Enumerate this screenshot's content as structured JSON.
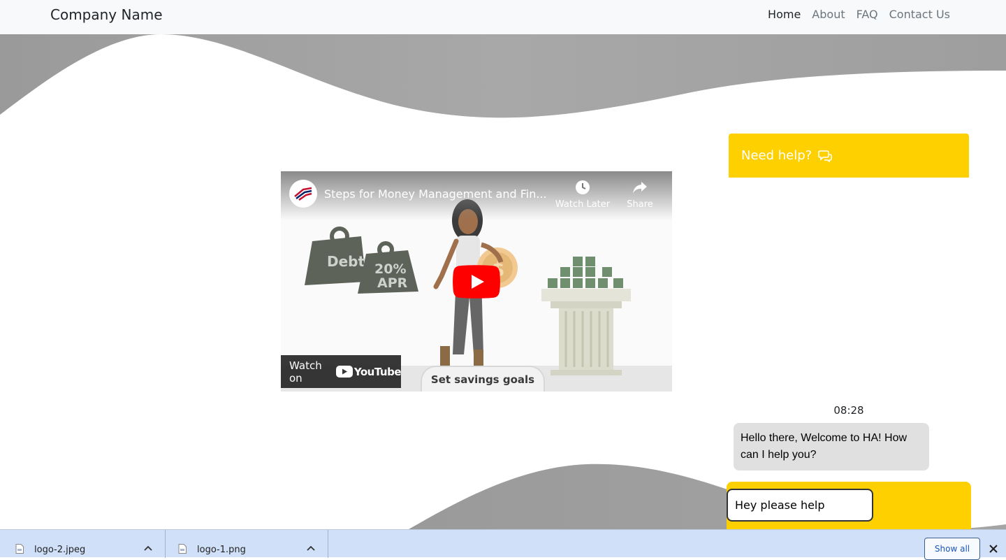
{
  "navbar": {
    "brand": "Company Name",
    "links": [
      {
        "label": "Home",
        "active": true
      },
      {
        "label": "About",
        "active": false
      },
      {
        "label": "FAQ",
        "active": false
      },
      {
        "label": "Contact Us",
        "active": false
      }
    ]
  },
  "video": {
    "title": "Steps for Money Management and Fin...",
    "watch_later": "Watch Later",
    "share": "Share",
    "watch_on": "Watch on",
    "youtube_word": "YouTube",
    "weight_1": "Debt",
    "weight_2_top": "20%",
    "weight_2_bottom": "APR",
    "caption": "Set savings goals"
  },
  "chat": {
    "header_title": "Need help?",
    "header_icon": "chat-bubbles-icon",
    "timestamp": "08:28",
    "bot_message": "Hello there, Welcome to HA! How can I help you?",
    "input_value": "Hey please help",
    "accent": "#ffd000"
  },
  "downloads": {
    "items": [
      {
        "name": "logo-2.jpeg"
      },
      {
        "name": "logo-1.png"
      }
    ],
    "show_all": "Show all"
  }
}
